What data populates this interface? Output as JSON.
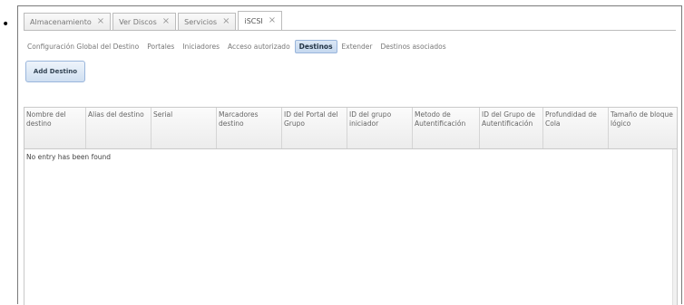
{
  "bullet": "•",
  "tabs": [
    {
      "label": "Almacenamiento",
      "close": "×",
      "active": false
    },
    {
      "label": "Ver Discos",
      "close": "×",
      "active": false
    },
    {
      "label": "Servicios",
      "close": "×",
      "active": false
    },
    {
      "label": "iSCSI",
      "close": "×",
      "active": true
    }
  ],
  "subnav": [
    {
      "label": "Configuración Global del Destino",
      "active": false
    },
    {
      "label": "Portales",
      "active": false
    },
    {
      "label": "Iniciadores",
      "active": false
    },
    {
      "label": "Acceso autorizado",
      "active": false
    },
    {
      "label": "Destinos",
      "active": true
    },
    {
      "label": "Extender",
      "active": false
    },
    {
      "label": "Destinos asociados",
      "active": false
    }
  ],
  "toolbar": {
    "add_label": "Add Destino"
  },
  "table": {
    "columns": [
      "Nombre del destino",
      "Alias del destino",
      "Serial",
      "Marcadores destino",
      "ID del Portal del Grupo",
      "ID del grupo iniciador",
      "Metodo de Autentificación",
      "ID del Grupo de Autentificación",
      "Profundidad de Cola",
      "Tamaño de bloque lógico"
    ],
    "empty_message": "No entry has been found"
  }
}
